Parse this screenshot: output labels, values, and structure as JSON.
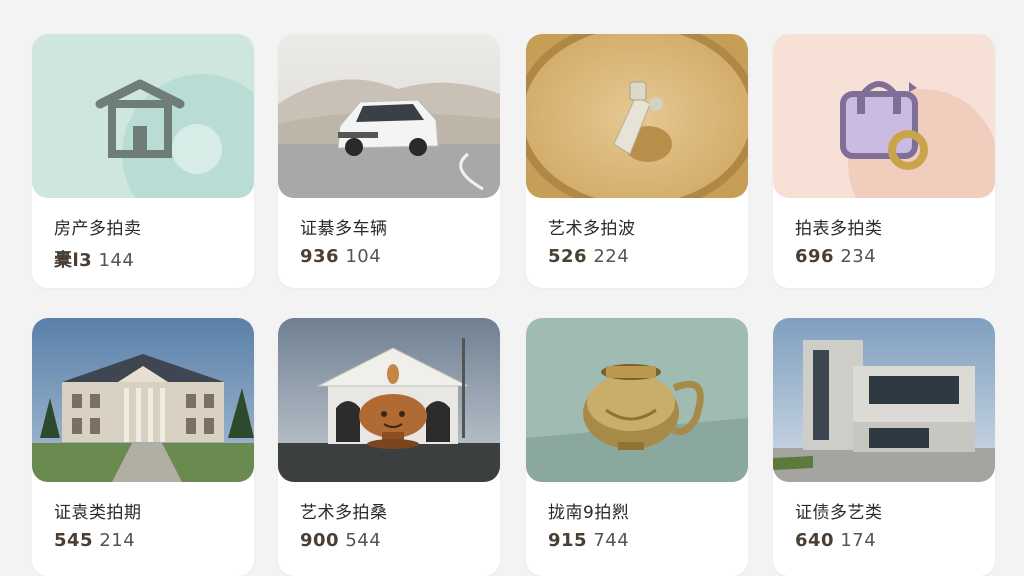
{
  "cards": [
    {
      "title": "房产多拍卖",
      "value_a": "橐l3",
      "value_b": "144",
      "icon": "house-icon"
    },
    {
      "title": "证綦多车辆",
      "value_a": "936",
      "value_b": "104",
      "icon": "car-image"
    },
    {
      "title": "艺术多拍波",
      "value_a": "526",
      "value_b": "224",
      "icon": "art-object-image"
    },
    {
      "title": "拍表多拍类",
      "value_a": "696",
      "value_b": "234",
      "icon": "bag-icon"
    },
    {
      "title": "证袁类拍期",
      "value_a": "545",
      "value_b": "214",
      "icon": "mansion-image"
    },
    {
      "title": "艺术多拍桑",
      "value_a": "900",
      "value_b": "544",
      "icon": "bronze-vessel-image"
    },
    {
      "title": "拢南9拍煭",
      "value_a": "915",
      "value_b": "744",
      "icon": "brass-pot-image"
    },
    {
      "title": "证债多艺类",
      "value_a": "640",
      "value_b": "174",
      "icon": "modern-building-image"
    }
  ]
}
